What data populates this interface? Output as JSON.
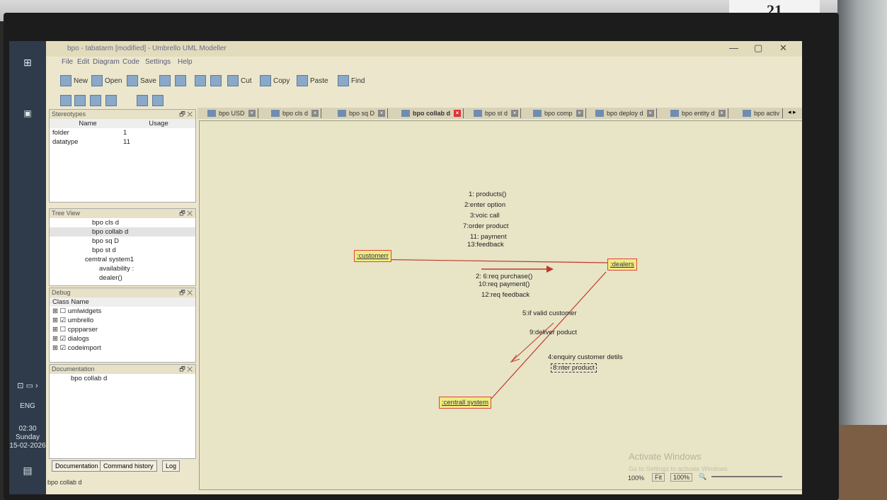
{
  "screen_label": "21",
  "window": {
    "title": "bpo - tabatarm [modified] - Umbrello UML Modeller",
    "controls": [
      "—",
      "▢",
      "✕"
    ]
  },
  "menu": [
    "File",
    "Edit",
    "Diagram",
    "Code",
    "Settings",
    "Help"
  ],
  "toolbar": {
    "new": "New",
    "open": "Open",
    "save": "Save",
    "cut": "Cut",
    "copy": "Copy",
    "paste": "Paste",
    "find": "Find"
  },
  "stereotypes": {
    "title": "Stereotypes",
    "columns": [
      "Name",
      "Usage"
    ],
    "rows": [
      [
        "folder",
        "1"
      ],
      [
        "datatype",
        "11"
      ]
    ]
  },
  "treeview": {
    "title": "Tree View",
    "items": [
      "bpo cls d",
      "bpo collab d",
      "bpo sq D",
      "bpo st d",
      "cemtral system1",
      "availability :",
      "dealer()"
    ]
  },
  "debug": {
    "title": "Debug",
    "header": "Class Name",
    "items": [
      {
        "label": "umlwidgets",
        "checked": false
      },
      {
        "label": "umbrello",
        "checked": true
      },
      {
        "label": "cppparser",
        "checked": false
      },
      {
        "label": "dialogs",
        "checked": true
      },
      {
        "label": "codeimport",
        "checked": true
      }
    ]
  },
  "documentation": {
    "title": "Documentation",
    "value": "bpo collab d"
  },
  "bottom_tabs": [
    "Documentation",
    "Command history",
    "Log"
  ],
  "status_left": "bpo collab d",
  "diagram_tabs": [
    {
      "label": "bpo USD",
      "active": false
    },
    {
      "label": "bpo cls d",
      "active": false
    },
    {
      "label": "bpo sq D",
      "active": false
    },
    {
      "label": "bpo collab d",
      "active": true
    },
    {
      "label": "bpo st d",
      "active": false
    },
    {
      "label": "bpo comp",
      "active": false
    },
    {
      "label": "bpo deploy d",
      "active": false
    },
    {
      "label": "bpo entity d",
      "active": false
    },
    {
      "label": "bpo activ",
      "active": false
    }
  ],
  "diagram": {
    "objects": {
      "customer": ":customerr",
      "dealers": ":dealers",
      "system": ":centrall system"
    },
    "msgs_top": [
      "1: products()",
      "2:enter option",
      "3:voic call",
      "7:order product",
      "11: payment",
      "13:feedback"
    ],
    "msgs_mid": [
      "2: 6:req purchase()",
      "10:req payment()",
      "12:req feedback"
    ],
    "msgs_right": [
      "5:if valid customer",
      "9:deliver poduct"
    ],
    "msgs_low": [
      "4:enquiry customer detils",
      "8:nter product"
    ]
  },
  "zoom": {
    "value": "100%",
    "fit": "Fit",
    "field": "100%"
  },
  "watermark": {
    "line1": "Activate Windows",
    "line2": "Go to Settings to activate Windows."
  },
  "taskbar": {
    "lang": "ENG",
    "time": "02:30",
    "day": "Sunday",
    "date": "15-02-2026"
  }
}
